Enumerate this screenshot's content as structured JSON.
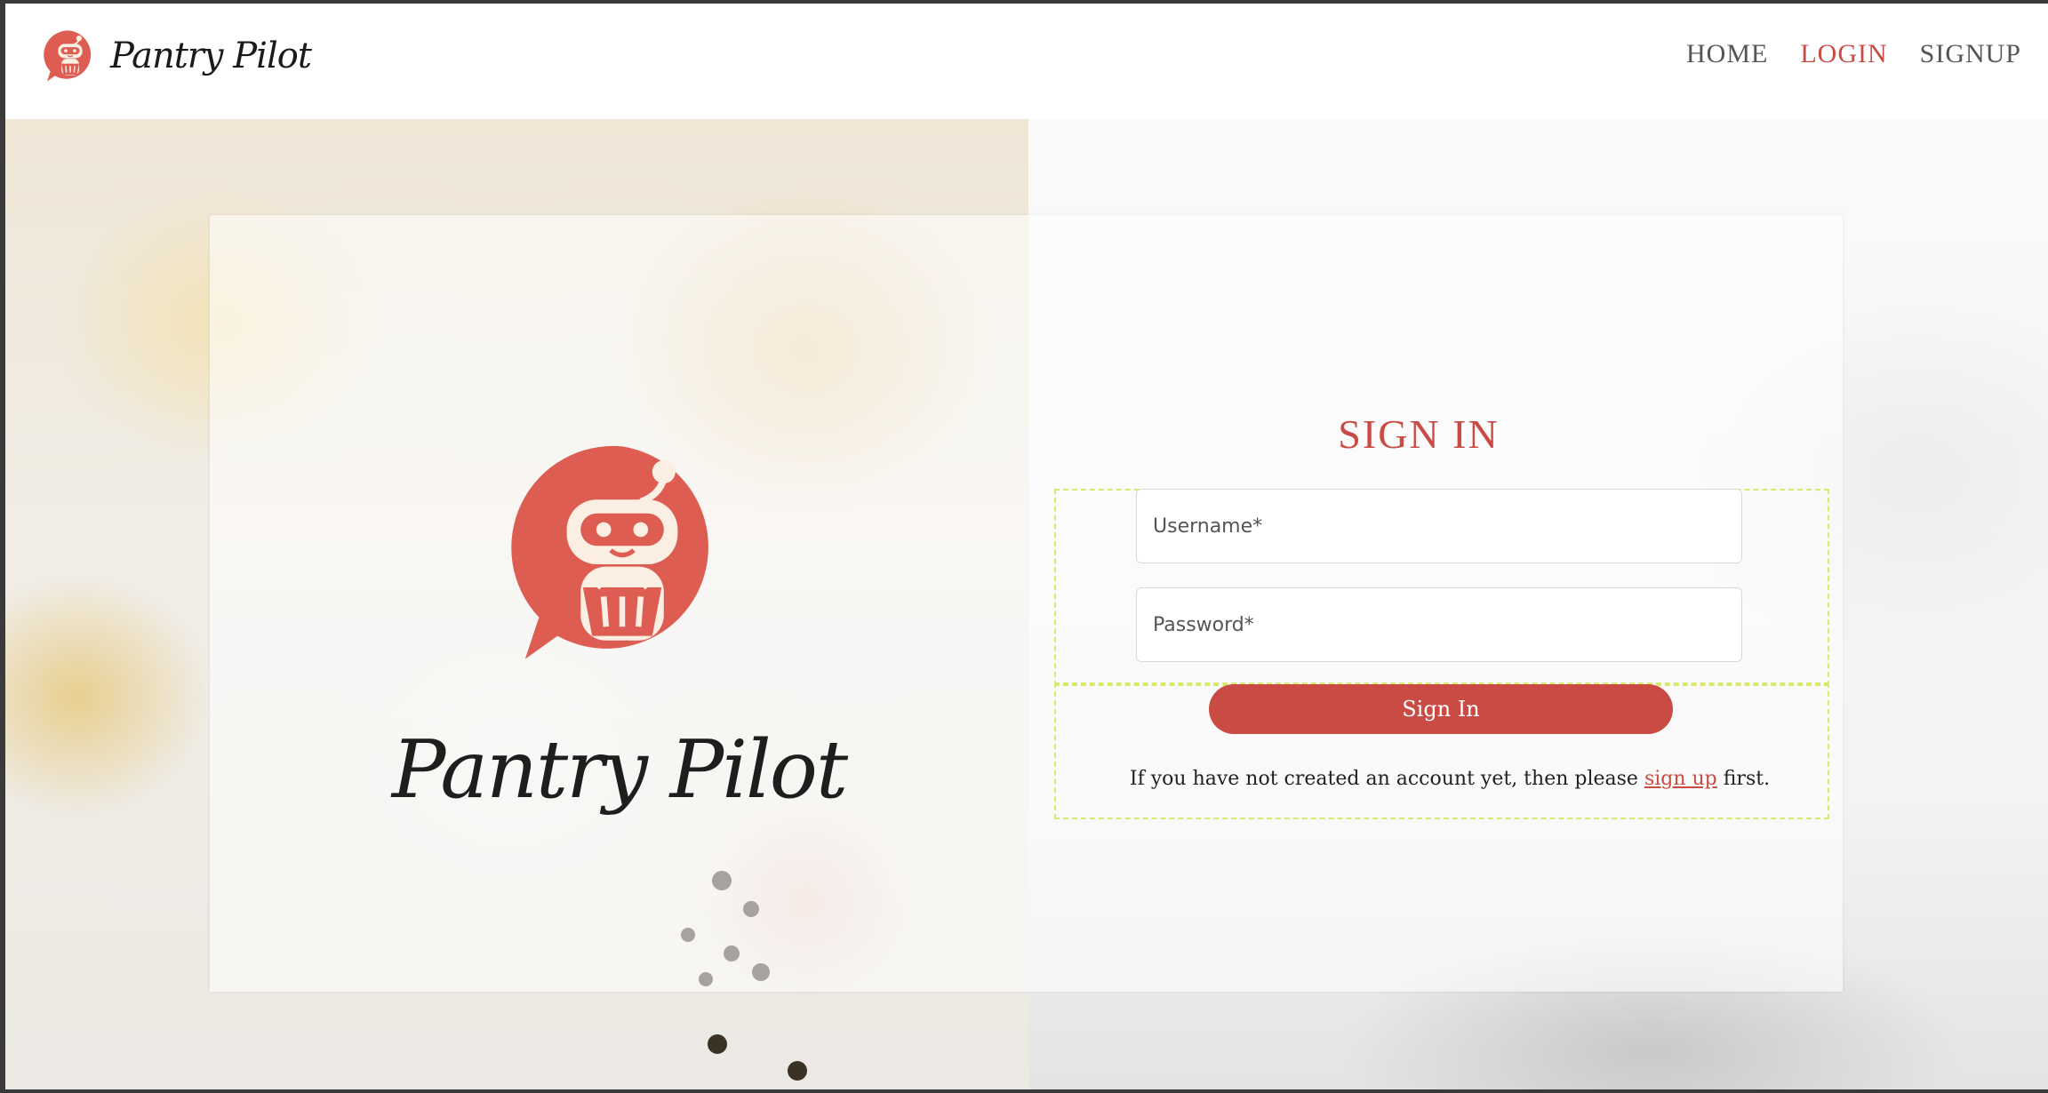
{
  "brand": {
    "name": "Pantry Pilot",
    "logo_icon": "robot-basket-logo"
  },
  "nav": {
    "home": "HOME",
    "login": "LOGIN",
    "signup": "SIGNUP",
    "active": "LOGIN"
  },
  "hero": {
    "brand_name": "Pantry Pilot"
  },
  "form": {
    "title": "SIGN IN",
    "username_placeholder": "Username*",
    "password_placeholder": "Password*",
    "submit_label": "Sign In",
    "hint_before": "If you have not created an account yet, then please ",
    "hint_link": "sign up",
    "hint_after": " first."
  },
  "colors": {
    "accent": "#c94b43",
    "logo": "#de5d52",
    "dashed_outline": "#dbe96b"
  }
}
